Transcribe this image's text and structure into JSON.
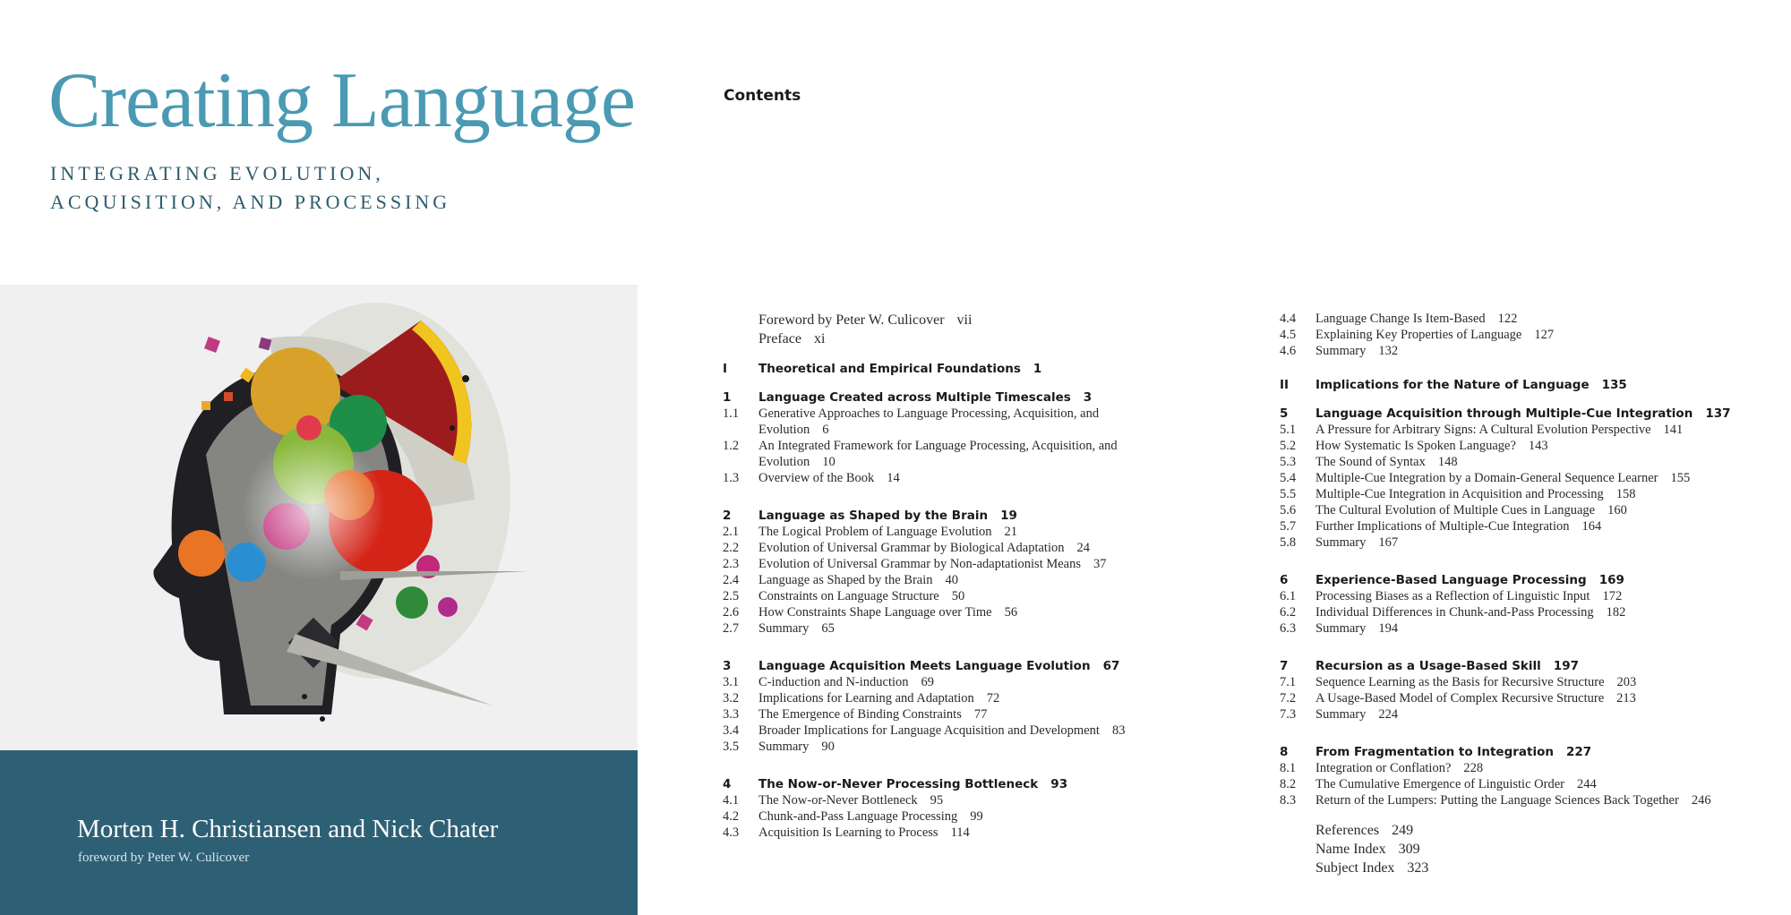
{
  "cover": {
    "title": "Creating Language",
    "subtitle_line1": "INTEGRATING EVOLUTION,",
    "subtitle_line2": "ACQUISITION, AND PROCESSING",
    "authors": "Morten H. Christiansen and Nick Chater",
    "foreword": "foreword by Peter W. Culicover"
  },
  "contents": {
    "heading": "Contents",
    "front": [
      {
        "text": "Foreword by Peter W. Culicover",
        "page": "vii"
      },
      {
        "text": "Preface",
        "page": "xi"
      }
    ],
    "part1": {
      "num": "I",
      "text": "Theoretical and Empirical Foundations",
      "page": "1"
    },
    "ch1": {
      "num": "1",
      "text": "Language Created across Multiple Timescales",
      "page": "3"
    },
    "ch1_sections": [
      {
        "num": "1.1",
        "text": "Generative Approaches to Language Processing, Acquisition, and",
        "text2": "Evolution",
        "page": "6"
      },
      {
        "num": "1.2",
        "text": "An Integrated Framework for Language Processing, Acquisition, and",
        "text2": "Evolution",
        "page": "10"
      },
      {
        "num": "1.3",
        "text": "Overview of the Book",
        "page": "14"
      }
    ],
    "ch2": {
      "num": "2",
      "text": "Language as Shaped by the Brain",
      "page": "19"
    },
    "ch2_sections": [
      {
        "num": "2.1",
        "text": "The Logical Problem of Language Evolution",
        "page": "21"
      },
      {
        "num": "2.2",
        "text": "Evolution of Universal Grammar by Biological Adaptation",
        "page": "24"
      },
      {
        "num": "2.3",
        "text": "Evolution of Universal Grammar by Non-adaptationist Means",
        "page": "37"
      },
      {
        "num": "2.4",
        "text": "Language as Shaped by the Brain",
        "page": "40"
      },
      {
        "num": "2.5",
        "text": "Constraints on Language Structure",
        "page": "50"
      },
      {
        "num": "2.6",
        "text": "How Constraints Shape Language over Time",
        "page": "56"
      },
      {
        "num": "2.7",
        "text": "Summary",
        "page": "65"
      }
    ],
    "ch3": {
      "num": "3",
      "text": "Language Acquisition Meets Language Evolution",
      "page": "67"
    },
    "ch3_sections": [
      {
        "num": "3.1",
        "text": "C-induction and N-induction",
        "page": "69"
      },
      {
        "num": "3.2",
        "text": "Implications for Learning and Adaptation",
        "page": "72"
      },
      {
        "num": "3.3",
        "text": "The Emergence of Binding Constraints",
        "page": "77"
      },
      {
        "num": "3.4",
        "text": "Broader Implications for Language Acquisition and Development",
        "page": "83"
      },
      {
        "num": "3.5",
        "text": "Summary",
        "page": "90"
      }
    ],
    "ch4": {
      "num": "4",
      "text": "The Now-or-Never Processing Bottleneck",
      "page": "93"
    },
    "ch4_sections": [
      {
        "num": "4.1",
        "text": "The Now-or-Never Bottleneck",
        "page": "95"
      },
      {
        "num": "4.2",
        "text": "Chunk-and-Pass Language Processing",
        "page": "99"
      },
      {
        "num": "4.3",
        "text": "Acquisition Is Learning to Process",
        "page": "114"
      },
      {
        "num": "4.4",
        "text": "Language Change Is Item-Based",
        "page": "122"
      },
      {
        "num": "4.5",
        "text": "Explaining Key Properties of Language",
        "page": "127"
      },
      {
        "num": "4.6",
        "text": "Summary",
        "page": "132"
      }
    ],
    "part2": {
      "num": "II",
      "text": "Implications for the Nature of Language",
      "page": "135"
    },
    "ch5": {
      "num": "5",
      "text": "Language Acquisition through Multiple-Cue Integration",
      "page": "137"
    },
    "ch5_sections": [
      {
        "num": "5.1",
        "text": "A Pressure for Arbitrary Signs: A Cultural Evolution Perspective",
        "page": "141"
      },
      {
        "num": "5.2",
        "text": "How Systematic Is Spoken Language?",
        "page": "143"
      },
      {
        "num": "5.3",
        "text": "The Sound of Syntax",
        "page": "148"
      },
      {
        "num": "5.4",
        "text": "Multiple-Cue Integration by a Domain-General Sequence Learner",
        "page": "155"
      },
      {
        "num": "5.5",
        "text": "Multiple-Cue Integration in Acquisition and Processing",
        "page": "158"
      },
      {
        "num": "5.6",
        "text": "The Cultural Evolution of Multiple Cues in Language",
        "page": "160"
      },
      {
        "num": "5.7",
        "text": "Further Implications of Multiple-Cue Integration",
        "page": "164"
      },
      {
        "num": "5.8",
        "text": "Summary",
        "page": "167"
      }
    ],
    "ch6": {
      "num": "6",
      "text": "Experience-Based Language Processing",
      "page": "169"
    },
    "ch6_sections": [
      {
        "num": "6.1",
        "text": "Processing Biases as a Reflection of Linguistic Input",
        "page": "172"
      },
      {
        "num": "6.2",
        "text": "Individual Differences in Chunk-and-Pass Processing",
        "page": "182"
      },
      {
        "num": "6.3",
        "text": "Summary",
        "page": "194"
      }
    ],
    "ch7": {
      "num": "7",
      "text": "Recursion as a Usage-Based Skill",
      "page": "197"
    },
    "ch7_sections": [
      {
        "num": "7.1",
        "text": "Sequence Learning as the Basis for Recursive Structure",
        "page": "203"
      },
      {
        "num": "7.2",
        "text": "A Usage-Based Model of Complex Recursive Structure",
        "page": "213"
      },
      {
        "num": "7.3",
        "text": "Summary",
        "page": "224"
      }
    ],
    "ch8": {
      "num": "8",
      "text": "From Fragmentation to Integration",
      "page": "227"
    },
    "ch8_sections": [
      {
        "num": "8.1",
        "text": "Integration or Conflation?",
        "page": "228"
      },
      {
        "num": "8.2",
        "text": "The Cumulative Emergence of Linguistic Order",
        "page": "244"
      },
      {
        "num": "8.3",
        "text": "Return of the Lumpers: Putting the Language Sciences Back Together",
        "page": "246"
      }
    ],
    "back": [
      {
        "text": "References",
        "page": "249"
      },
      {
        "text": "Name Index",
        "page": "309"
      },
      {
        "text": "Subject Index",
        "page": "323"
      }
    ]
  }
}
